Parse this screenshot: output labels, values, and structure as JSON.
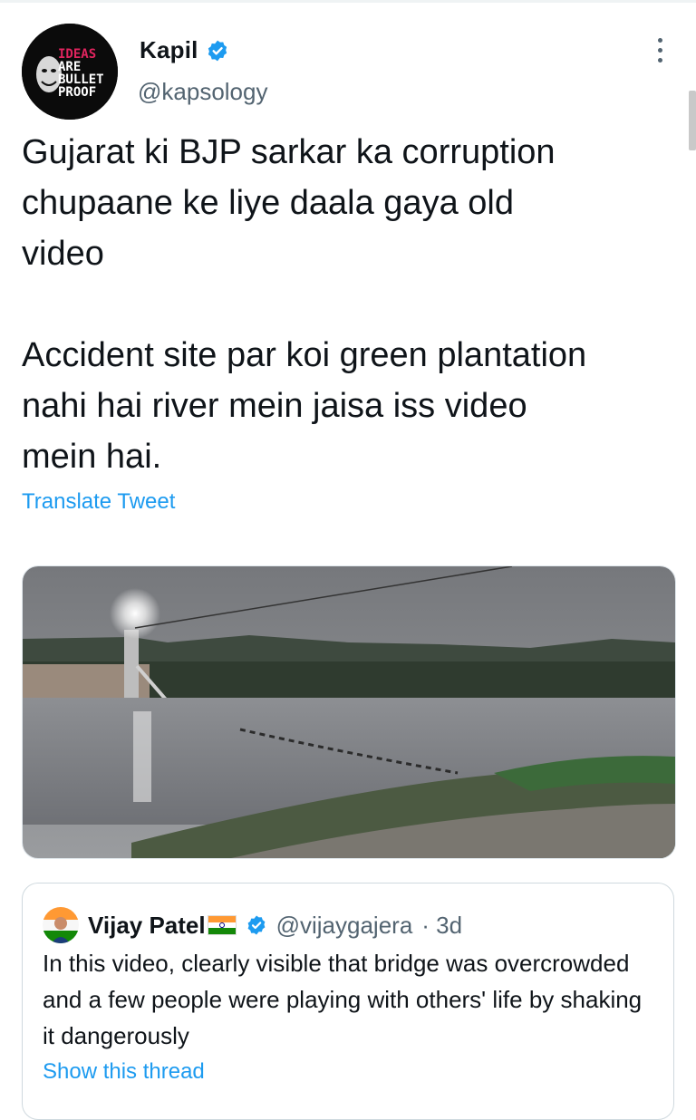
{
  "author": {
    "name": "Kapil",
    "handle": "@kapsology",
    "avatar_text": [
      "IDEAS",
      "ARE",
      "BULLET",
      "PROOF"
    ],
    "verified_icon": "verified-badge-icon"
  },
  "tweet": {
    "text": "Gujarat ki BJP sarkar ka corruption\nchupaane ke liye daala gaya old\nvideo\n\nAccident site par koi green plantation\nnahi hai river mein jaisa iss video\nmein hai.",
    "translate_label": "Translate Tweet"
  },
  "media": {
    "description_icon": "video-thumbnail-river-bridge"
  },
  "quoted_tweet": {
    "name": "Vijay Patel",
    "flag_icon": "india-flag-icon",
    "handle": "@vijaygajera",
    "time": "· 3d",
    "text": "In this video, clearly visible that bridge was overcrowded and a few people were playing with others' life by shaking it dangerously",
    "show_thread_label": "Show this thread"
  },
  "colors": {
    "accent": "#1d9bf0",
    "secondary_text": "#536471",
    "primary_text": "#0f1419"
  }
}
